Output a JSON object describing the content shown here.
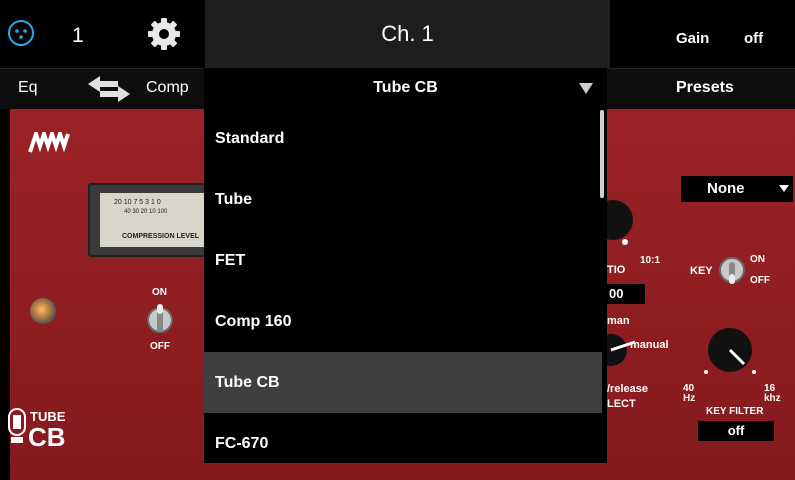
{
  "topbar": {
    "channel_number": "1",
    "channel_title": "Ch. 1",
    "gain_label": "Gain",
    "gain_value": "off"
  },
  "secondbar": {
    "eq_label": "Eq",
    "comp_label": "Comp",
    "presets_label": "Presets"
  },
  "dropdown": {
    "selected": "Tube CB",
    "items": [
      "Standard",
      "Tube",
      "FET",
      "Comp 160",
      "Tube CB",
      "FC-670"
    ],
    "selected_index": 4
  },
  "plugin": {
    "meter_label": "COMPRESSION LEVEL",
    "meter_scale": "20 10 7 5 3 1 0",
    "meter_scale2": "40 30 20 10 100",
    "switch_on": "ON",
    "switch_off": "OFF",
    "ratio_label": "TIO",
    "ratio_max": "10:1",
    "ratio_value": "00",
    "attack_label": "man",
    "manual_label": "manual",
    "release_label": "/release",
    "select_label": "LECT",
    "key_label": "KEY",
    "key_on": "ON",
    "key_off": "OFF",
    "key_filter_label": "KEY FILTER",
    "key_filter_value": "off",
    "key_filter_min": "40\nHz",
    "key_filter_max": "16\nkhz",
    "sidechain_value": "None",
    "tube_label": "TUBE",
    "cb_label": "CB"
  },
  "colors": {
    "accent_blue": "#2aa7e8",
    "panel_red": "#8a1a1e",
    "selected_row": "#3f3f3f"
  }
}
